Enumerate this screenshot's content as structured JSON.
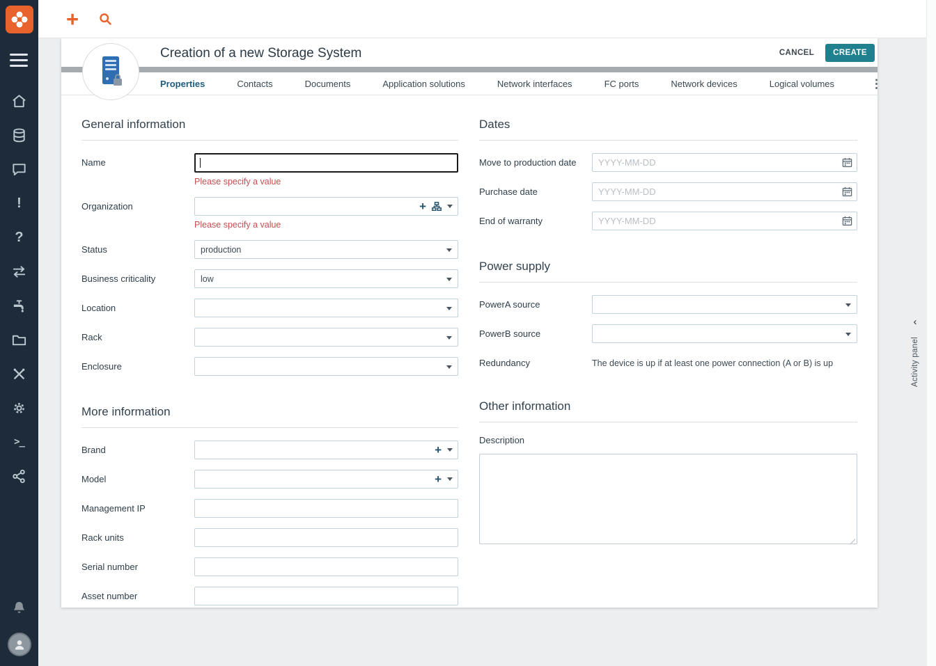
{
  "colors": {
    "accent": "#e8632c",
    "primary": "#1f8190",
    "sidebar": "#1d2b3a",
    "error": "#c44f4f",
    "tabactive": "#1f5b7d"
  },
  "icons": {
    "plus": "+",
    "kebab": "⋮",
    "chevron_left": "‹",
    "exclamation": "!",
    "question": "?",
    "terminal": ">_"
  },
  "header": {
    "title": "Creation of a new Storage System",
    "cancel_label": "CANCEL",
    "create_label": "CREATE"
  },
  "tabs": [
    "Properties",
    "Contacts",
    "Documents",
    "Application solutions",
    "Network interfaces",
    "FC ports",
    "Network devices",
    "Logical volumes"
  ],
  "form": {
    "general": {
      "title": "General information",
      "name_label": "Name",
      "name_error": "Please specify a value",
      "organization_label": "Organization",
      "organization_error": "Please specify a value",
      "status_label": "Status",
      "status_value": "production",
      "criticality_label": "Business criticality",
      "criticality_value": "low",
      "location_label": "Location",
      "rack_label": "Rack",
      "enclosure_label": "Enclosure"
    },
    "more": {
      "title": "More information",
      "brand_label": "Brand",
      "model_label": "Model",
      "management_ip_label": "Management IP",
      "rack_units_label": "Rack units",
      "serial_label": "Serial number",
      "asset_label": "Asset number"
    },
    "dates": {
      "title": "Dates",
      "placeholder": "YYYY-MM-DD",
      "move_label": "Move to production date",
      "purchase_label": "Purchase date",
      "warranty_label": "End of warranty"
    },
    "power": {
      "title": "Power supply",
      "powera_label": "PowerA source",
      "powerb_label": "PowerB source",
      "redundancy_label": "Redundancy",
      "redundancy_text": "The device is up if at least one power connection (A or B) is up"
    },
    "other": {
      "title": "Other information",
      "description_label": "Description"
    }
  },
  "activity_panel": {
    "label": "Activity panel"
  }
}
